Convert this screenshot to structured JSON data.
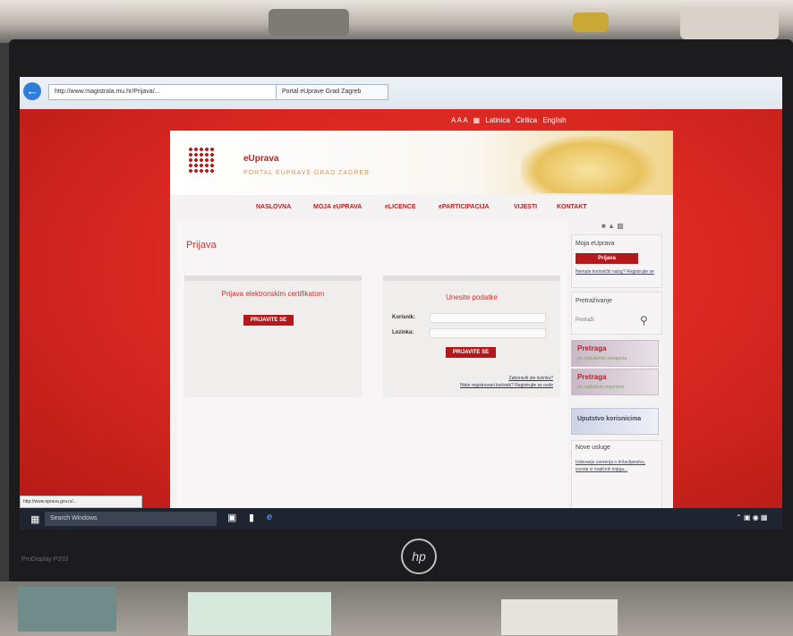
{
  "browser": {
    "address": "http://www.magistrala.mu.hr/Prijava/...",
    "tab_label": "Portal eUprave Grad Zagreb"
  },
  "top_links": {
    "font_sizes": "A A A",
    "latin": "Latinica",
    "cyrillic": "Ćirilica",
    "english": "English"
  },
  "site": {
    "name": "eUprava",
    "subtitle": "PORTAL EUPRAVE GRAD ZAGREB"
  },
  "nav": [
    "NASLOVNA",
    "MOJA eUPRAVA",
    "eLICENCE",
    "ePARTICIPACIJA",
    "VIJESTI",
    "KONTAKT"
  ],
  "main": {
    "title": "Prijava",
    "left_panel": {
      "title": "Prijava elektronskim certifikatom",
      "button": "PRIJAVITE SE"
    },
    "right_panel": {
      "title": "Unesite podatke",
      "label_user": "Korisnik:",
      "label_pass": "Lozinka:",
      "button": "PRIJAVITE SE",
      "link_forgot": "Zaboravili ste lozinku?",
      "link_register": "Niste registrovani korisnik? Registrujte se ovde"
    }
  },
  "sidebar": {
    "my_title": "Moja eUprava",
    "login_button": "Prijava",
    "account_link": "Nemate korisnički nalog? Registrujte se",
    "search_title": "Pretraživanje",
    "search_placeholder": "Pretraži",
    "promo1_title": "Pretraga",
    "promo1_sub": "po objavljenim uslugama",
    "promo2_title": "Pretraga",
    "promo2_sub": "po nadležnim organima",
    "promo3_title": "Uputstvo korisnicima",
    "news_title": "Nove usluge",
    "news_item": "Izdavanje uverenja o državljanstvu, izvoda iz matičnih knjiga..."
  },
  "taskbar": {
    "search": "Search Windows"
  },
  "status_url": "http://www.eprava.gov.rs/...",
  "monitor": {
    "model": "ProDisplay P203",
    "brand": "hp"
  },
  "colors": {
    "brand_red": "#b5181a",
    "background_red": "#d82a25"
  }
}
